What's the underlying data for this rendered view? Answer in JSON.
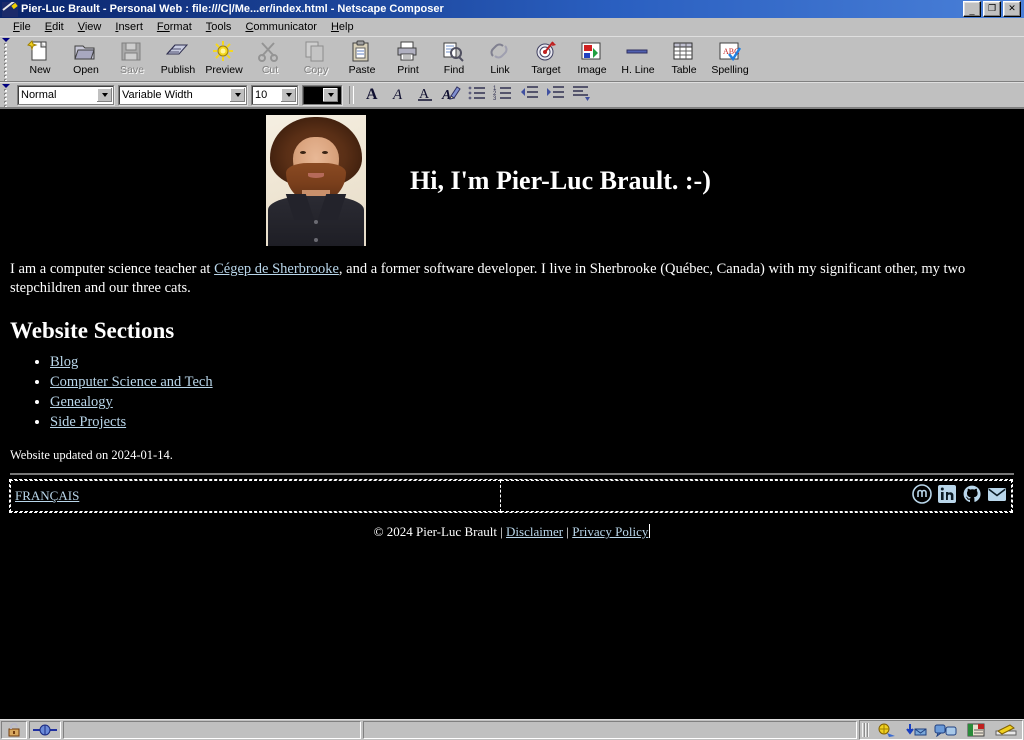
{
  "window": {
    "title": "Pier-Luc Brault - Personal Web : file:///C|/Me...er/index.html - Netscape Composer",
    "icon": "composer-pen-icon",
    "minimize_label": "_",
    "restore_label": "❐",
    "close_label": "✕"
  },
  "menubar": {
    "items": [
      {
        "name": "file",
        "acc": "F",
        "rest": "ile"
      },
      {
        "name": "edit",
        "acc": "E",
        "rest": "dit"
      },
      {
        "name": "view",
        "acc": "V",
        "rest": "iew"
      },
      {
        "name": "insert",
        "acc": "I",
        "rest": "nsert"
      },
      {
        "name": "format",
        "acc": "Fo",
        "rest": "rmat"
      },
      {
        "name": "tools",
        "acc": "T",
        "rest": "ools"
      },
      {
        "name": "communicator",
        "acc": "C",
        "rest": "ommunicator"
      },
      {
        "name": "help",
        "acc": "H",
        "rest": "elp"
      }
    ]
  },
  "toolbar": {
    "buttons": [
      {
        "label": "New",
        "icon": "new-page-icon",
        "enabled": true
      },
      {
        "label": "Open",
        "icon": "open-folder-icon",
        "enabled": true
      },
      {
        "label": "Save",
        "icon": "save-disk-icon",
        "enabled": false
      },
      {
        "label": "Publish",
        "icon": "publish-icon",
        "enabled": true
      },
      {
        "label": "Preview",
        "icon": "preview-sun-icon",
        "enabled": true
      },
      {
        "label": "Cut",
        "icon": "scissors-icon",
        "enabled": false
      },
      {
        "label": "Copy",
        "icon": "copy-icon",
        "enabled": false
      },
      {
        "label": "Paste",
        "icon": "paste-clipboard-icon",
        "enabled": true
      },
      {
        "label": "Print",
        "icon": "printer-icon",
        "enabled": true
      },
      {
        "label": "Find",
        "icon": "find-binoculars-icon",
        "enabled": true
      },
      {
        "label": "Link",
        "icon": "link-chain-icon",
        "enabled": true
      },
      {
        "label": "Target",
        "icon": "target-icon",
        "enabled": true
      },
      {
        "label": "Image",
        "icon": "image-icon",
        "enabled": true
      },
      {
        "label": "H. Line",
        "icon": "horizontal-line-icon",
        "enabled": true
      },
      {
        "label": "Table",
        "icon": "table-grid-icon",
        "enabled": true
      },
      {
        "label": "Spelling",
        "icon": "spellcheck-icon",
        "enabled": true
      }
    ]
  },
  "formatbar": {
    "paragraph_style": "Normal",
    "font_family": "Variable Width",
    "font_size": "10",
    "text_color": "#000000",
    "buttons": [
      {
        "name": "bold-button",
        "icon": "bold-A-icon"
      },
      {
        "name": "italic-button",
        "icon": "italic-A-icon"
      },
      {
        "name": "underline-button",
        "icon": "underline-A-icon"
      },
      {
        "name": "text-color-button",
        "icon": "highlight-pen-icon"
      },
      {
        "name": "bullet-list-button",
        "icon": "bullet-list-icon"
      },
      {
        "name": "numbered-list-button",
        "icon": "numbered-list-icon"
      },
      {
        "name": "outdent-button",
        "icon": "outdent-icon"
      },
      {
        "name": "indent-button",
        "icon": "indent-icon"
      },
      {
        "name": "align-button",
        "icon": "align-left-icon"
      }
    ]
  },
  "document": {
    "heading": "Hi, I'm Pier-Luc Brault. :-)",
    "portrait_alt": "portrait-photo",
    "intro_before": "I am a computer science teacher at ",
    "intro_link": "Cégep de Sherbrooke",
    "intro_after": ", and a former software developer. I live in Sherbrooke (Québec, Canada) with my significant other, my two stepchildren and our three cats.",
    "sections_heading": "Website Sections",
    "sections": [
      "Blog",
      "Computer Science and Tech",
      "Genealogy",
      "Side Projects"
    ],
    "updated": "Website updated on 2024-01-14.",
    "lang_link": "FRANÇAIS",
    "social": [
      {
        "name": "mastodon-icon",
        "label": "Mastodon"
      },
      {
        "name": "linkedin-icon",
        "label": "LinkedIn"
      },
      {
        "name": "github-icon",
        "label": "GitHub"
      },
      {
        "name": "email-icon",
        "label": "Email"
      }
    ],
    "copyright_text": "© 2024 Pier-Luc Brault",
    "sep1": " | ",
    "disclaimer_link": "Disclaimer",
    "sep2": " | ",
    "privacy_link": "Privacy Policy",
    "link_color": "#b9d6ea",
    "background_color": "#000000",
    "text_color": "#ffffff"
  },
  "statusbar": {
    "lock_icon": "padlock-icon",
    "connection_icon": "online-indicator-icon",
    "message": "",
    "progress": "",
    "component_buttons": [
      {
        "name": "navigator-button",
        "icon": "navigator-globe-icon"
      },
      {
        "name": "mailbox-button",
        "icon": "inbox-download-icon"
      },
      {
        "name": "discussions-button",
        "icon": "discussion-bubbles-icon"
      },
      {
        "name": "addressbook-button",
        "icon": "address-book-icon"
      },
      {
        "name": "composer-button",
        "icon": "composer-pen-icon"
      }
    ]
  }
}
